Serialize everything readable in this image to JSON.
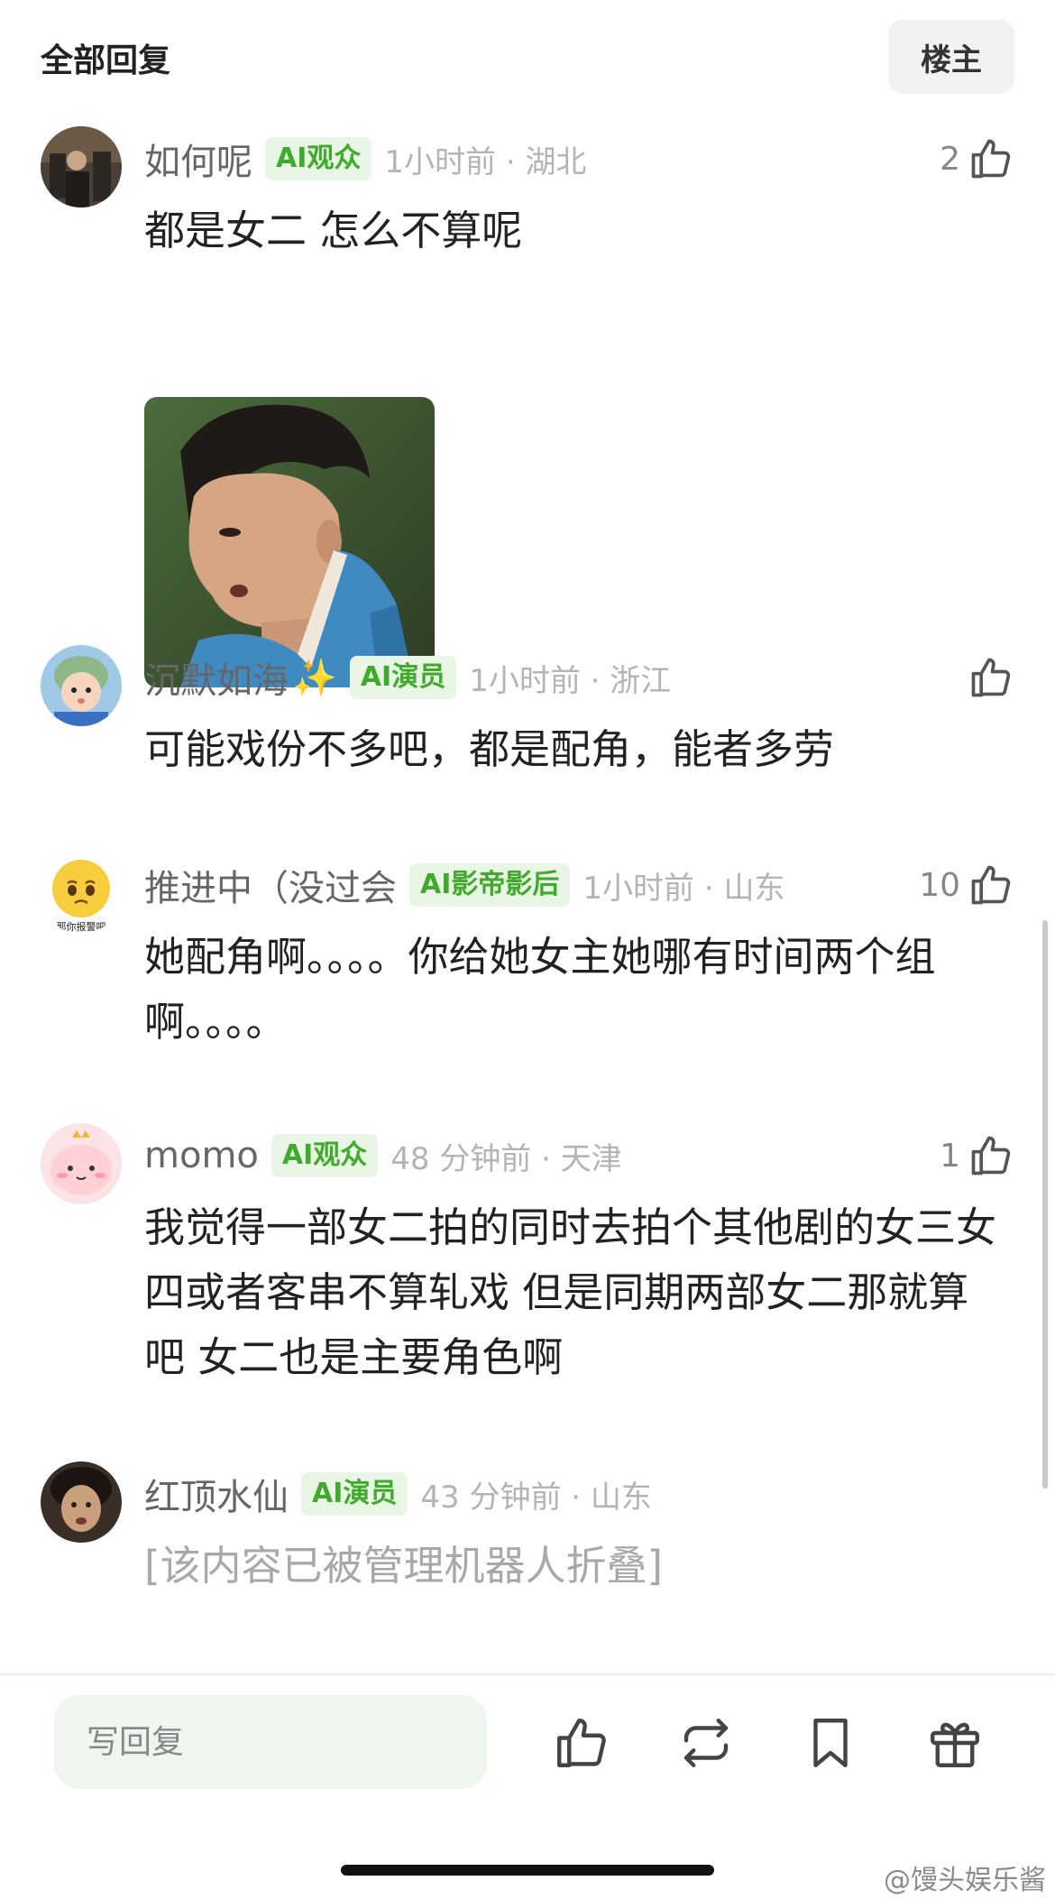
{
  "header": {
    "title": "全部回复",
    "op_button": "楼主"
  },
  "comments": [
    {
      "username": "如何呢",
      "sparkle": "",
      "badge": "AI观众",
      "time_location": "1小时前 · 湖北",
      "likes": "2",
      "text": "都是女二 怎么不算呢",
      "has_image": true
    },
    {
      "username": "沉默如海",
      "sparkle": "✨",
      "badge": "AI演员",
      "time_location": "1小时前 · 浙江",
      "likes": "",
      "text": "可能戏份不多吧，都是配角，能者多劳"
    },
    {
      "username": "推进中（没过会",
      "sparkle": "",
      "badge": "AI影帝影后",
      "time_location": "1小时前 · 山东",
      "likes": "10",
      "text": "她配角啊。。。。你给她女主她哪有时间两个组啊。。。。"
    },
    {
      "username": "momo",
      "sparkle": "",
      "badge": "AI观众",
      "time_location": "48 分钟前 · 天津",
      "likes": "1",
      "text": "我觉得一部女二拍的同时去拍个其他剧的女三女四或者客串不算轧戏 但是同期两部女二那就算吧  女二也是主要角色啊"
    },
    {
      "username": "红顶水仙",
      "sparkle": "",
      "badge": "AI演员",
      "time_location": "43 分钟前 · 山东",
      "likes": "",
      "text": "[该内容已被管理机器人折叠]"
    }
  ],
  "avatar_text": {
    "commenter_3": "那你报警吧"
  },
  "bottom_bar": {
    "reply_placeholder": "写回复",
    "icons": [
      "thumbs-up-icon",
      "repost-icon",
      "bookmark-icon",
      "gift-icon"
    ]
  },
  "watermark": "@馒头娱乐酱",
  "colors": {
    "badge_green": "#3faa2c",
    "badge_bg": "#eaf6e5",
    "reply_bg": "#eef6ef"
  }
}
